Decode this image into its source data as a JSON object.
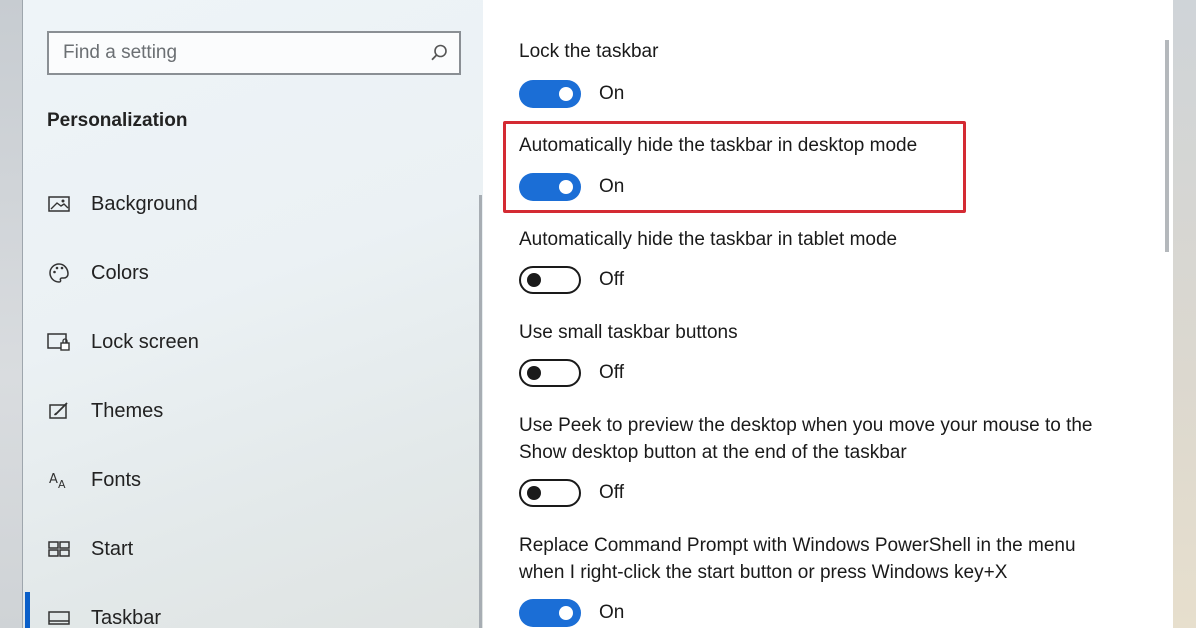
{
  "sidebar": {
    "search": {
      "placeholder": "Find a setting",
      "value": ""
    },
    "section_title": "Personalization",
    "items": [
      {
        "label": "Background",
        "icon": "image-icon"
      },
      {
        "label": "Colors",
        "icon": "palette-icon"
      },
      {
        "label": "Lock screen",
        "icon": "lock-screen-icon"
      },
      {
        "label": "Themes",
        "icon": "themes-icon"
      },
      {
        "label": "Fonts",
        "icon": "fonts-icon"
      },
      {
        "label": "Start",
        "icon": "start-icon"
      },
      {
        "label": "Taskbar",
        "icon": "taskbar-icon",
        "active": true
      }
    ]
  },
  "settings": [
    {
      "label": "Lock the taskbar",
      "state": "On"
    },
    {
      "label": "Automatically hide the taskbar in desktop mode",
      "state": "On",
      "highlighted": true
    },
    {
      "label": "Automatically hide the taskbar in tablet mode",
      "state": "Off"
    },
    {
      "label": "Use small taskbar buttons",
      "state": "Off"
    },
    {
      "label_line1": "Use Peek to preview the desktop when you move your mouse to the",
      "label_line2": "Show desktop button at the end of the taskbar",
      "state": "Off"
    },
    {
      "label_line1": "Replace Command Prompt with Windows PowerShell in the menu",
      "label_line2": "when I right-click the start button or press Windows key+X",
      "state": "On"
    }
  ],
  "colors": {
    "accent": "#1b6ed6",
    "highlight": "#d42a33"
  }
}
